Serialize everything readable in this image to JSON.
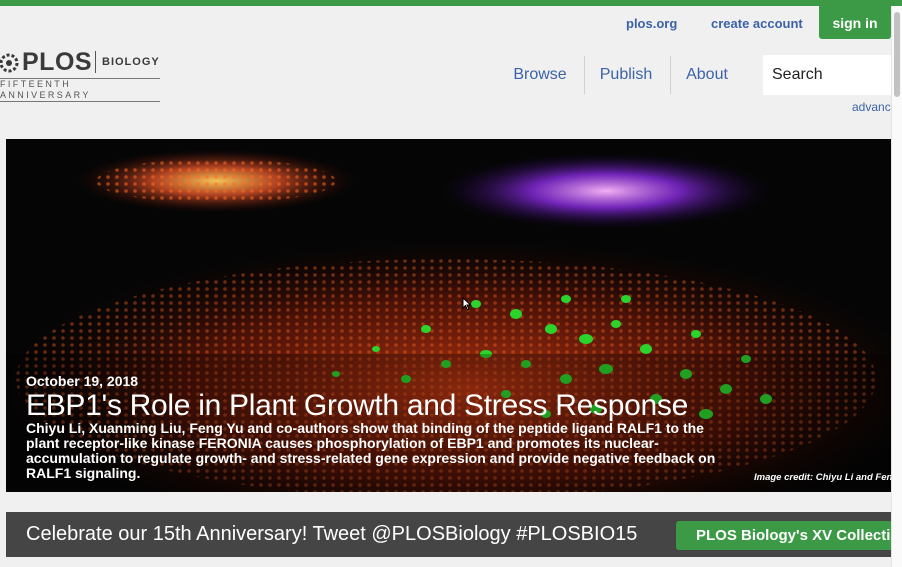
{
  "header": {
    "links": {
      "plos_org": "plos.org",
      "create_account": "create account",
      "sign_in": "sign in"
    },
    "logo": {
      "plos": "PLOS",
      "journal": "BIOLOGY",
      "anniversary": "FIFTEENTH ANNIVERSARY"
    },
    "nav": [
      "Browse",
      "Publish",
      "About"
    ],
    "search": {
      "value": "",
      "placeholder": "Search"
    },
    "advanced_search": "advanc"
  },
  "hero": {
    "date": "October 19, 2018",
    "title": "EBP1's Role in Plant Growth and Stress Response",
    "description": "Chiyu Li, Xuanming Liu, Feng Yu and co-authors show that binding of the peptide ligand RALF1 to the plant receptor-like kinase FERONIA causes phosphorylation of EBP1 and promotes its nuclear-accumulation to regulate growth- and stress-related gene expression and provide negative feedback on RALF1 signaling.",
    "credit": "Image credit: Chiyu Li and Feng"
  },
  "banner": {
    "text": "Celebrate our 15th Anniversary! Tweet @PLOSBiology #PLOSBIO15",
    "button": "PLOS Biology's XV Collectio"
  },
  "colors": {
    "brand_green": "#3c9a46",
    "link_blue": "#3c63a8",
    "banner_gray": "#454545"
  },
  "icons": {
    "logo_mark": "plos-gear-icon",
    "cursor": "mouse-pointer-icon"
  }
}
